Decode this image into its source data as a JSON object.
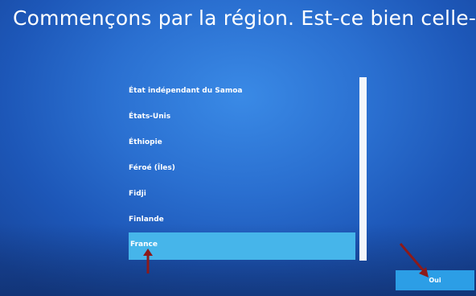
{
  "header": {
    "title": "Commençons par la région. Est-ce bien celle-là ?"
  },
  "region_list": {
    "items": [
      {
        "label": "État indépendant du Samoa",
        "selected": false
      },
      {
        "label": "États-Unis",
        "selected": false
      },
      {
        "label": "Éthiopie",
        "selected": false
      },
      {
        "label": "Féroé (Îles)",
        "selected": false
      },
      {
        "label": "Fidji",
        "selected": false
      },
      {
        "label": "Finlande",
        "selected": false
      },
      {
        "label": "France",
        "selected": true
      }
    ]
  },
  "footer": {
    "confirm_label": "Oui"
  },
  "annotations": {
    "arrow_color": "#8c1a1a"
  },
  "colors": {
    "selection": "#46b5ea",
    "button": "#2c9ee6",
    "background": "#2a6fd0"
  }
}
